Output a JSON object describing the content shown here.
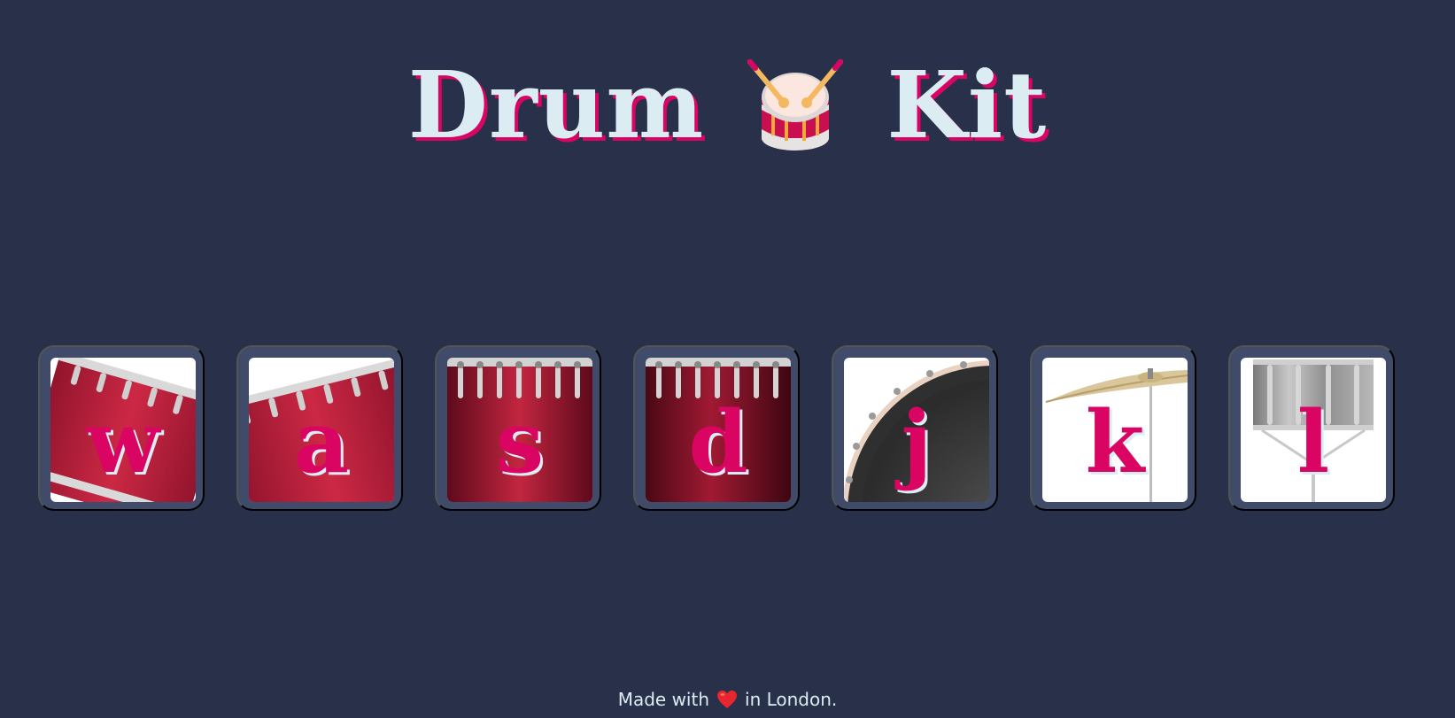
{
  "title": {
    "word_left": "Drum",
    "emoji": "drum-icon",
    "word_right": "Kit"
  },
  "colors": {
    "background": "#283149",
    "pad_border": "#404b69",
    "accent": "#da0463",
    "text_light": "#dbedf3"
  },
  "drums": [
    {
      "key": "w",
      "image": "tom-1-icon"
    },
    {
      "key": "a",
      "image": "tom-2-icon"
    },
    {
      "key": "s",
      "image": "tom-3-icon"
    },
    {
      "key": "d",
      "image": "tom-4-icon"
    },
    {
      "key": "j",
      "image": "kick-bass-icon"
    },
    {
      "key": "k",
      "image": "crash-cymbal-icon"
    },
    {
      "key": "l",
      "image": "snare-icon"
    }
  ],
  "footer": {
    "before": "Made with",
    "icon": "heart-icon",
    "after": "in London."
  }
}
